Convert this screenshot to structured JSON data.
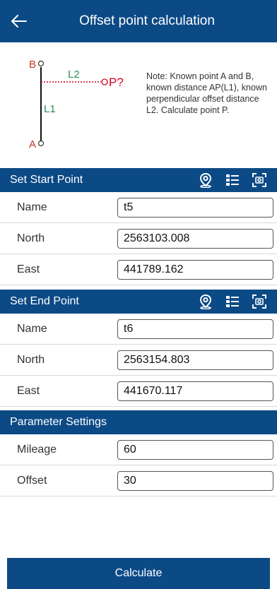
{
  "header": {
    "title": "Offset point calculation"
  },
  "diagram": {
    "label_b": "B",
    "label_a": "A",
    "label_l1": "L1",
    "label_l2": "L2",
    "label_p": "P?",
    "note": "Note: Known point A and B, known distance AP(L1), known perpendicular offset distance L2. Calculate point P."
  },
  "start_point": {
    "title": "Set Start Point",
    "name_label": "Name",
    "name_value": "t5",
    "north_label": "North",
    "north_value": "2563103.008",
    "east_label": "East",
    "east_value": "441789.162"
  },
  "end_point": {
    "title": "Set End Point",
    "name_label": "Name",
    "name_value": "t6",
    "north_label": "North",
    "north_value": "2563154.803",
    "east_label": "East",
    "east_value": "441670.117"
  },
  "parameters": {
    "title": "Parameter Settings",
    "mileage_label": "Mileage",
    "mileage_value": "60",
    "offset_label": "Offset",
    "offset_value": "30"
  },
  "actions": {
    "calculate_label": "Calculate"
  },
  "colors": {
    "primary": "#0c4a86",
    "offset_line": "#d6001c",
    "diagram_label": "#c0392b",
    "l1_label": "#2e8b57"
  },
  "icons": [
    "back-arrow-icon",
    "map-pin-icon",
    "list-icon",
    "scan-icon"
  ]
}
